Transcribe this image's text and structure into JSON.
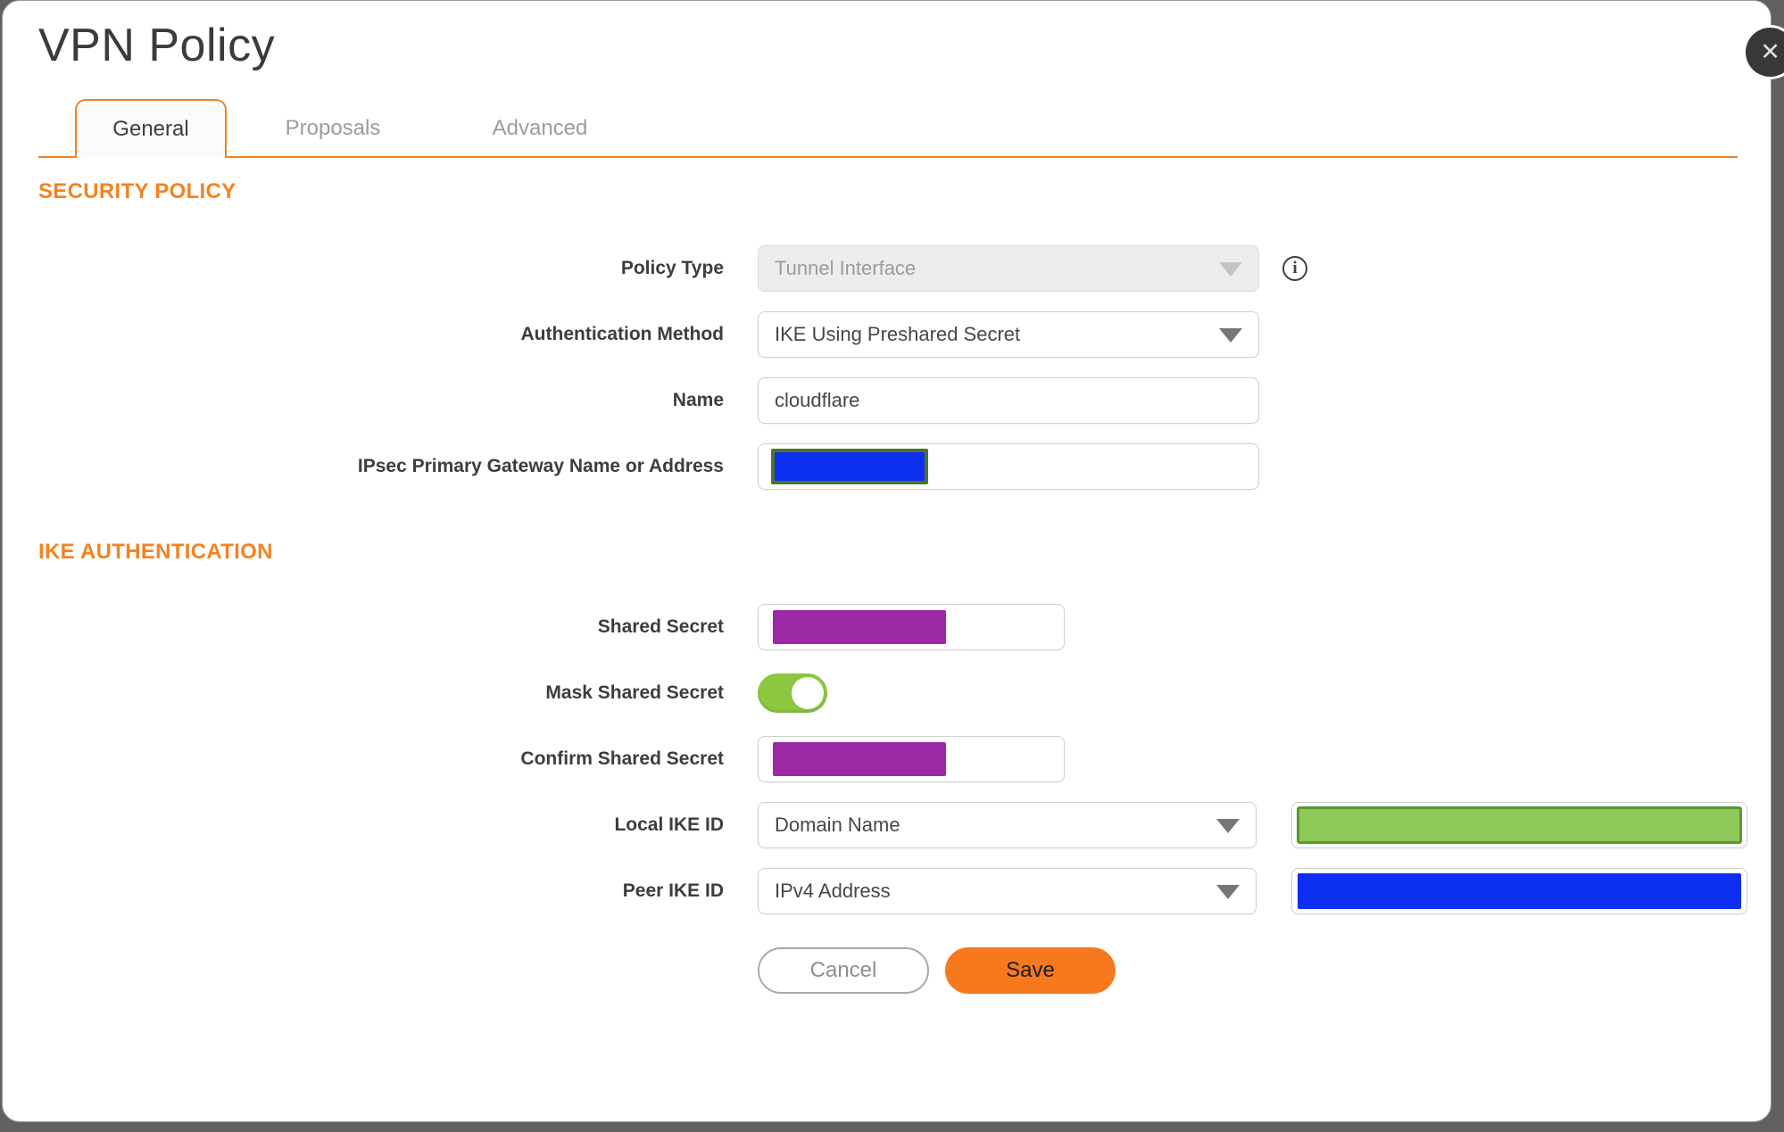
{
  "dialog": {
    "title": "VPN Policy"
  },
  "icons": {
    "close": "✕",
    "info": "i",
    "dropdown": "chevron-down"
  },
  "tabs": [
    {
      "label": "General",
      "active": true
    },
    {
      "label": "Proposals",
      "active": false
    },
    {
      "label": "Advanced",
      "active": false
    }
  ],
  "security_policy": {
    "heading": "SECURITY POLICY",
    "policy_type": {
      "label": "Policy Type",
      "value": "Tunnel Interface",
      "disabled": true
    },
    "authentication_method": {
      "label": "Authentication Method",
      "value": "IKE Using Preshared Secret"
    },
    "name": {
      "label": "Name",
      "value": "cloudflare"
    },
    "gateway": {
      "label": "IPsec Primary Gateway Name or Address",
      "value": "",
      "redacted": true
    }
  },
  "ike_authentication": {
    "heading": "IKE AUTHENTICATION",
    "shared_secret": {
      "label": "Shared Secret",
      "value": "",
      "redacted": true
    },
    "mask_shared_secret": {
      "label": "Mask Shared Secret",
      "state": "on"
    },
    "confirm_shared_secret": {
      "label": "Confirm Shared Secret",
      "value": "",
      "redacted": true
    },
    "local_ike_id": {
      "label": "Local IKE ID",
      "value": "Domain Name",
      "id_value": "",
      "id_redacted": true
    },
    "peer_ike_id": {
      "label": "Peer IKE ID",
      "value": "IPv4 Address",
      "id_value": "",
      "id_redacted": true
    }
  },
  "footer": {
    "cancel_label": "Cancel",
    "save_label": "Save"
  },
  "colors": {
    "backdrop_gray": "#616161",
    "accent_orange": "#f58220",
    "save_button_orange": "#f8791d",
    "toggle_green": "#8dc63f",
    "redact_purple": "#9d28a6",
    "redact_blue": "#0c2ff2",
    "redact_blue_border": "#4c7527",
    "redact_green": "#8ec95a",
    "redact_green_border": "#569b2f"
  }
}
